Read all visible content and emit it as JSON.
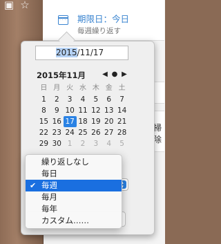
{
  "task": {
    "due_label": "期限日：今日",
    "repeat_label": "毎週繰り返す"
  },
  "background": {
    "right_text": "掃除"
  },
  "picker": {
    "date_value_selected": "2015",
    "date_value_rest": "/11/17",
    "month_title": "2015年11月",
    "nav_prev": "◀",
    "nav_today": "●",
    "nav_next": "▶",
    "weekdays": [
      "日",
      "月",
      "火",
      "水",
      "木",
      "金",
      "土"
    ],
    "weeks": [
      [
        "1",
        "2",
        "3",
        "4",
        "5",
        "6",
        "7"
      ],
      [
        "8",
        "9",
        "10",
        "11",
        "12",
        "13",
        "14"
      ],
      [
        "15",
        "16",
        "17",
        "18",
        "19",
        "20",
        "21"
      ],
      [
        "22",
        "23",
        "24",
        "25",
        "26",
        "27",
        "28"
      ],
      [
        "29",
        "30",
        "1",
        "2",
        "3",
        "4",
        "5"
      ]
    ],
    "selected_day": "17"
  },
  "repeat_menu": {
    "items": [
      {
        "label": "繰り返しなし",
        "checked": false
      },
      {
        "label": "毎日",
        "checked": false
      },
      {
        "label": "毎週",
        "checked": true
      },
      {
        "label": "毎月",
        "checked": false
      },
      {
        "label": "毎年",
        "checked": false
      },
      {
        "label": "カスタム……",
        "checked": false
      }
    ],
    "check_glyph": "✔"
  },
  "icons": {
    "top_bar": [
      "lock-icon",
      "star-icon"
    ],
    "task": "calendar-icon",
    "stepper": "up-down-stepper-icon"
  },
  "colors": {
    "accent": "#2a82e4",
    "due_text": "#3a84d0"
  }
}
